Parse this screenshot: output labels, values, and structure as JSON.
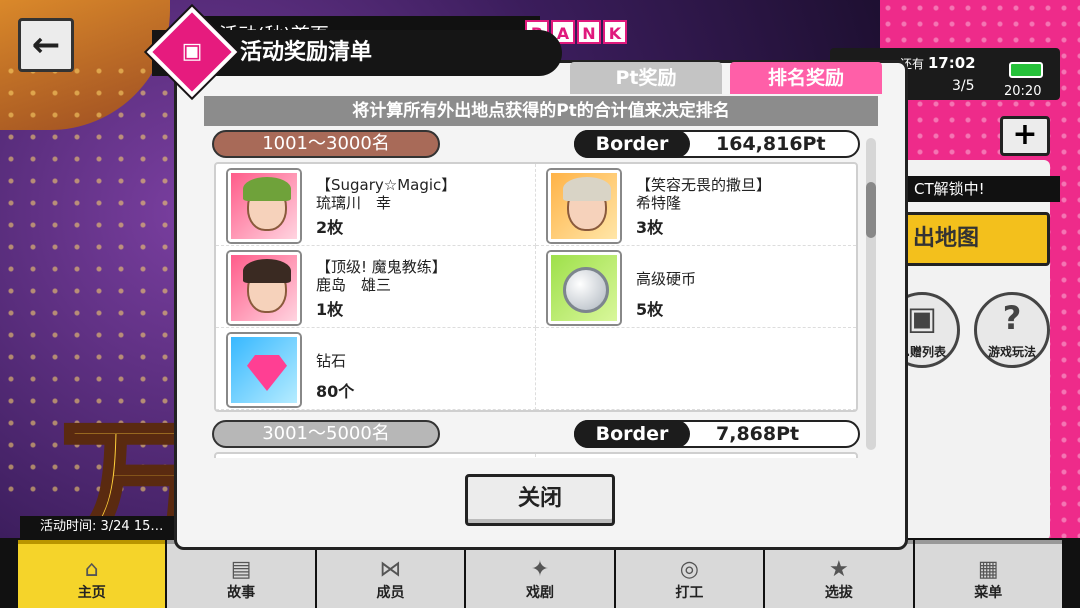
{
  "background": {
    "top_title": "…活动(秋)首页",
    "rank_letters": [
      "R",
      "A",
      "N",
      "K"
    ],
    "stamina_label": "还有",
    "stamina_timer": "17:02",
    "stamina_count": "3/5",
    "clock": "20:20",
    "unlock_banner": "CT解锁中!",
    "map_button": "出地图",
    "gift_list_button": "…赠列表",
    "game_rules_button": "游戏玩法",
    "big_letter": "万",
    "event_time": "活动时间: 3/24 15…",
    "accent_pink": "#ee2b8a",
    "accent_yellow": "#f5d42a"
  },
  "nav": [
    {
      "label": "主页",
      "icon": "home-icon"
    },
    {
      "label": "故事",
      "icon": "book-icon"
    },
    {
      "label": "成员",
      "icon": "bow-icon"
    },
    {
      "label": "戏剧",
      "icon": "drama-icon"
    },
    {
      "label": "打工",
      "icon": "coins-icon"
    },
    {
      "label": "选拔",
      "icon": "star-icon"
    },
    {
      "label": "菜单",
      "icon": "grid-icon"
    }
  ],
  "modal": {
    "title": "活动奖励清单",
    "tabs": {
      "pt": "Pt奖励",
      "rank": "排名奖励"
    },
    "notice": "将计算所有外出地点获得的Pt的合计值来决定排名",
    "tiers": [
      {
        "range": "1001～3000名",
        "border_label": "Border",
        "border_value": "164,816Pt",
        "rewards": [
          {
            "title": "【Sugary☆Magic】",
            "name": "琉璃川　幸",
            "qty": "2枚",
            "thumb": "card-portrait-pink"
          },
          {
            "title": "【笑容无畏的撒旦】",
            "name": "希特隆",
            "qty": "3枚",
            "thumb": "card-portrait-orange"
          },
          {
            "title": "【顶级! 魔鬼教练】",
            "name": "鹿岛　雄三",
            "qty": "1枚",
            "thumb": "card-portrait-pink"
          },
          {
            "title": "",
            "name": "高级硬币",
            "qty": "5枚",
            "thumb": "coin-icon"
          },
          {
            "title": "",
            "name": "钻石",
            "qty": "80个",
            "thumb": "diamond-icon"
          }
        ]
      },
      {
        "range": "3001～5000名",
        "border_label": "Border",
        "border_value": "7,868Pt"
      }
    ],
    "close_button": "关闭"
  }
}
